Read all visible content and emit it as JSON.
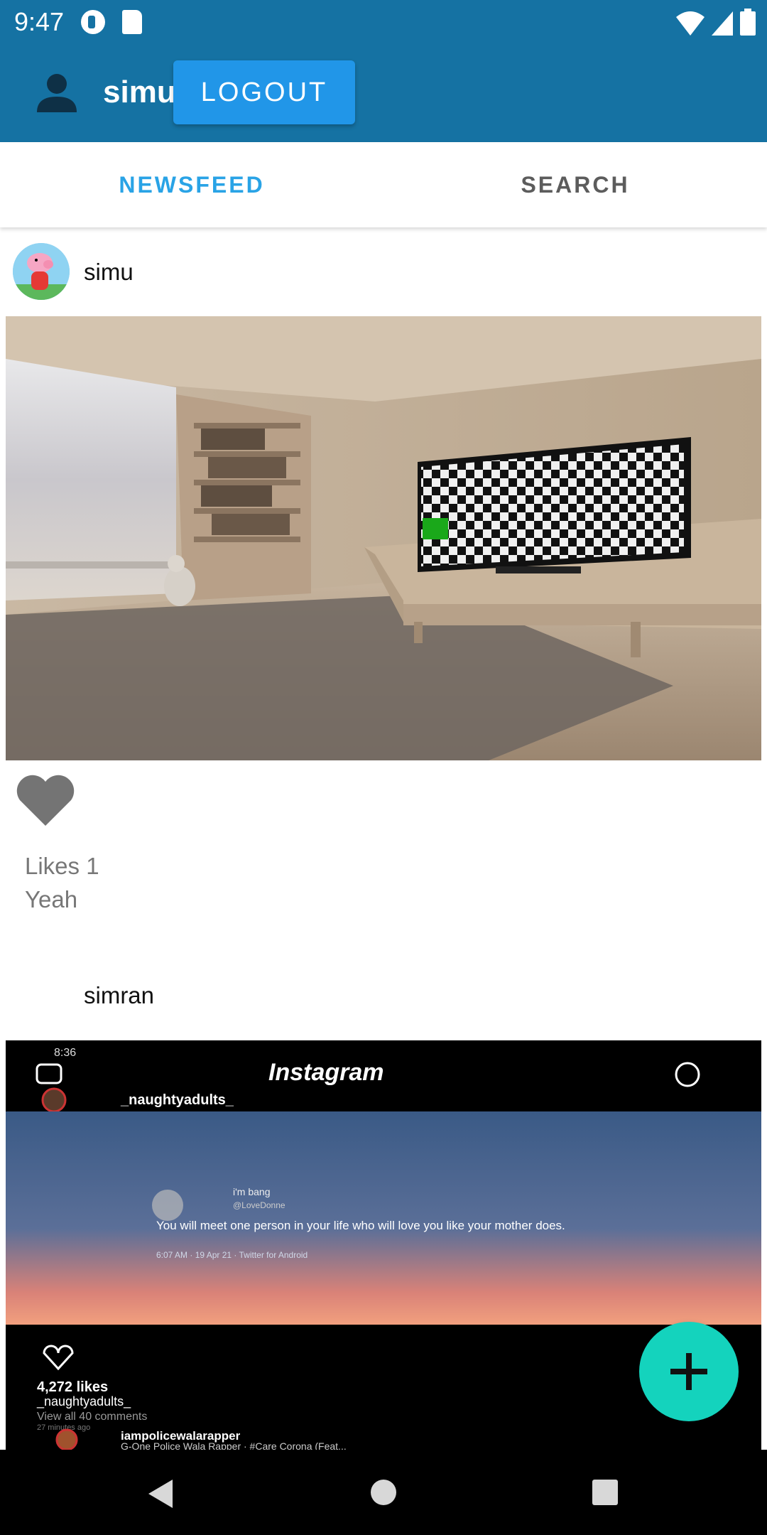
{
  "status_bar": {
    "time": "9:47"
  },
  "app_bar": {
    "username": "simu",
    "logout_label": "LOGOUT"
  },
  "tabs": [
    {
      "label": "NEWSFEED",
      "active": true
    },
    {
      "label": "SEARCH",
      "active": false
    }
  ],
  "feed": {
    "posts": [
      {
        "author": "simu",
        "image": "room-with-tv-photo",
        "likes_text": "Likes 1",
        "caption": "Yeah"
      },
      {
        "author": "simran",
        "image": "instagram-screenshot",
        "screenshot_texts": {
          "time": "8:36",
          "app_title": "Instagram",
          "account": "_naughtyadults_",
          "tweet_name": "i'm bang",
          "tweet_handle": "@LoveDonne",
          "tweet_text": "You will meet one person in your life who will love you like your mother does.",
          "tweet_meta": "6:07 AM · 19 Apr 21 · Twitter for Android",
          "likes": "4,272 likes",
          "caption_user": "_naughtyadults_",
          "comments": "View all 40 comments",
          "time_ago": "27 minutes ago",
          "next_user": "iampolicewalarapper",
          "next_sub": "G-One Police Wala Rapper · #Care Corona (Feat..."
        }
      }
    ]
  },
  "colors": {
    "app_bar": "#1572a3",
    "logout_button": "#2196e8",
    "tab_active": "#29a3e6",
    "fab": "#14d3bd"
  }
}
